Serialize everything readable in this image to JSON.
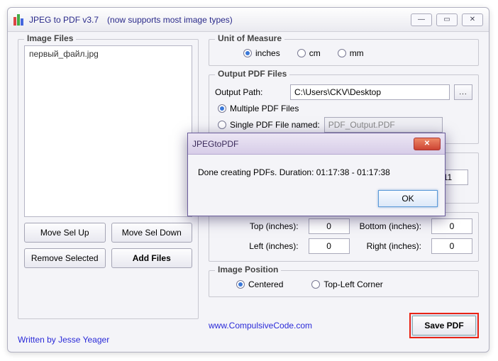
{
  "window": {
    "title": "JPEG to PDF  v3.7",
    "tagline": "(now supports most image types)"
  },
  "left": {
    "fieldset_label": "Image Files",
    "items": [
      "первый_файл.jpg"
    ],
    "move_up": "Move Sel Up",
    "move_down": "Move Sel Down",
    "remove": "Remove Selected",
    "add": "Add Files"
  },
  "unit": {
    "fieldset_label": "Unit of Measure",
    "inches": "inches",
    "cm": "cm",
    "mm": "mm"
  },
  "output": {
    "fieldset_label": "Output PDF Files",
    "path_label": "Output Path:",
    "path_value": "C:\\Users\\CKV\\Desktop",
    "multiple": "Multiple PDF Files",
    "single": "Single PDF File named:",
    "single_name": "PDF_Output.PDF"
  },
  "page": {
    "eleven": "11"
  },
  "margins": {
    "top_label": "Top (inches):",
    "top_value": "0",
    "bottom_label": "Bottom (inches):",
    "bottom_value": "0",
    "left_label": "Left (inches):",
    "left_value": "0",
    "right_label": "Right (inches):",
    "right_value": "0"
  },
  "position": {
    "fieldset_label": "Image Position",
    "centered": "Centered",
    "topleft": "Top-Left Corner"
  },
  "footer": {
    "written_by": "Written by Jesse Yeager",
    "site": "www.CompulsiveCode.com",
    "save": "Save PDF"
  },
  "dialog": {
    "title": "JPEGtoPDF",
    "message": "Done creating PDFs.  Duration:  01:17:38 - 01:17:38",
    "ok": "OK"
  }
}
